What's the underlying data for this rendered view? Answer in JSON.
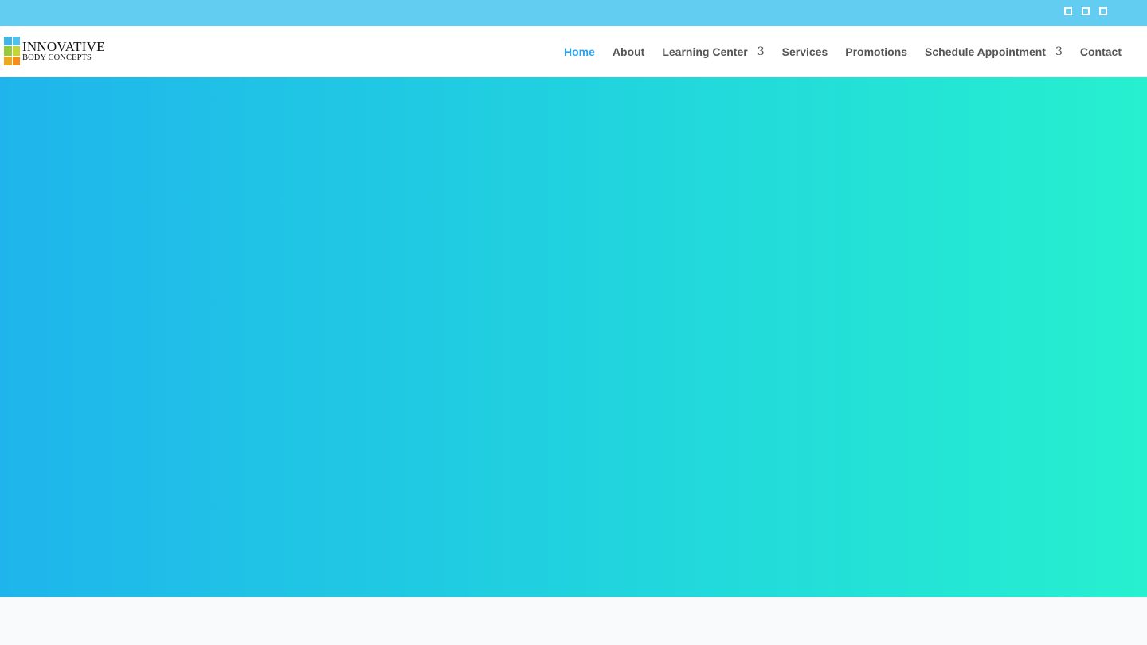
{
  "top_bar": {
    "background": "#62ccf1",
    "social_icons": [
      {
        "name": "social-icon"
      },
      {
        "name": "social-icon"
      },
      {
        "name": "social-icon"
      }
    ]
  },
  "header": {
    "logo": {
      "line1": "INNOVATIVE",
      "line2": "BODY CONCEPTS"
    },
    "nav": [
      {
        "label": "Home",
        "active": true
      },
      {
        "label": "About"
      },
      {
        "label": "Learning Center",
        "caret": "3"
      },
      {
        "label": "Services"
      },
      {
        "label": "Promotions"
      },
      {
        "label": "Schedule Appointment",
        "caret": "3"
      },
      {
        "label": "Contact"
      }
    ],
    "active_color": "#2ea3f2",
    "text_color": "#555555"
  },
  "hero": {
    "gradient_start": "#1fb5ec",
    "gradient_end": "#26f0cf"
  }
}
